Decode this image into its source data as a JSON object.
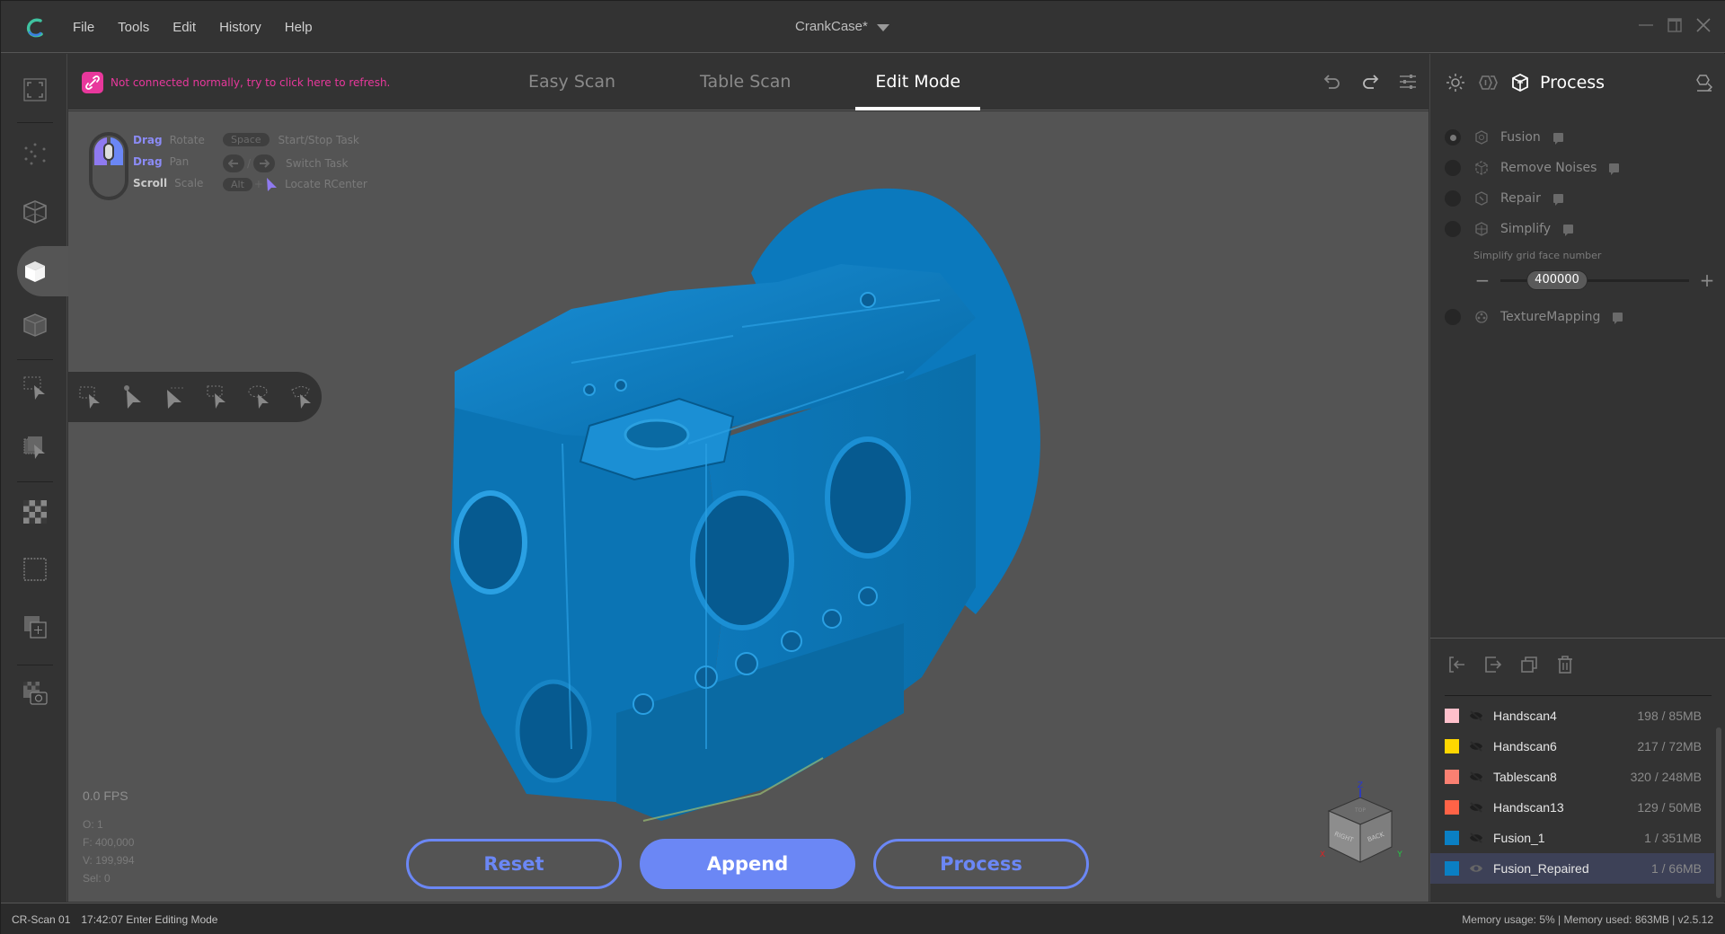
{
  "app": {
    "logo": "crealscan-logo-icon",
    "menu": [
      "File",
      "Tools",
      "Edit",
      "History",
      "Help"
    ],
    "document_title": "CrankCase*",
    "window_controls": [
      "minimize-icon",
      "maximize-icon",
      "close-icon"
    ]
  },
  "header": {
    "warning": "Not connected normally, try to click here to refresh.",
    "tabs": [
      {
        "label": "Easy Scan",
        "active": false
      },
      {
        "label": "Table Scan",
        "active": false
      },
      {
        "label": "Edit Mode",
        "active": true
      }
    ],
    "tools": [
      "undo-icon",
      "redo-icon",
      "settings-sliders-icon"
    ]
  },
  "left_toolbar": {
    "items": [
      "fit-view-icon",
      "point-cloud-icon",
      "wireframe-cube-icon",
      "solid-cube-icon",
      "transparent-cube-icon",
      "rect-select-icon",
      "through-select-icon",
      "checker-texture-icon",
      "dashed-box-icon",
      "add-layer-icon",
      "texture-camera-icon"
    ],
    "active_item": "solid-cube-icon"
  },
  "selection_toolbar": {
    "items": [
      "point-select-icon",
      "brush-select-icon",
      "line-select-icon",
      "rect-select-icon",
      "lasso-select-icon",
      "polygon-select-icon"
    ]
  },
  "hints": {
    "rows": [
      {
        "key": "Drag",
        "action": "Rotate",
        "shortcut": "Space",
        "shortcut_action": "Start/Stop Task"
      },
      {
        "key": "Drag",
        "action": "Pan",
        "shortcut": "← / →",
        "shortcut_action": "Switch Task"
      },
      {
        "key": "Scroll",
        "action": "Scale",
        "shortcut": "Alt +",
        "shortcut_action": "Locate RCenter"
      }
    ],
    "arrow_separator": "/",
    "plus": "+"
  },
  "viewport": {
    "fps": "0.0 FPS",
    "stats": [
      "O: 1",
      "F: 400,000",
      "V: 199,994",
      "Sel: 0"
    ],
    "model_color": "#0a7fc4",
    "background": "#545454",
    "navcube": {
      "faces": [
        "TOP",
        "RIGHT",
        "BACK"
      ],
      "axes": [
        "Z",
        "X",
        "Y"
      ]
    }
  },
  "actions": {
    "reset": "Reset",
    "append": "Append",
    "process": "Process",
    "accent": "#6b87f5"
  },
  "right_panel": {
    "title": "Process",
    "header_icons": [
      "lighting-icon",
      "texture-toggle-icon",
      "process-cube-icon",
      "export-icon"
    ],
    "steps": [
      {
        "label": "Fusion",
        "checked": true,
        "icon": "fusion-icon"
      },
      {
        "label": "Remove Noises",
        "checked": false,
        "icon": "remove-noises-icon"
      },
      {
        "label": "Repair",
        "checked": false,
        "icon": "repair-icon"
      },
      {
        "label": "Simplify",
        "checked": false,
        "icon": "simplify-icon"
      },
      {
        "label": "TextureMapping",
        "checked": false,
        "icon": "texture-mapping-icon"
      }
    ],
    "simplify": {
      "label": "Simplify grid face number",
      "value": "400000",
      "slider_fraction": 0.2,
      "minus": "−",
      "plus": "+"
    },
    "layer_tools": [
      "import-icon",
      "export-layer-icon",
      "duplicate-icon",
      "delete-icon"
    ],
    "layers": [
      {
        "name": "Handscan4",
        "info": "198 / 85MB",
        "color": "#ffc0cb",
        "visible": false,
        "selected": false
      },
      {
        "name": "Handscan6",
        "info": "217 / 72MB",
        "color": "#ffd700",
        "visible": false,
        "selected": false
      },
      {
        "name": "Tablescan8",
        "info": "320 / 248MB",
        "color": "#fa8072",
        "visible": false,
        "selected": false
      },
      {
        "name": "Handscan13",
        "info": "129 / 50MB",
        "color": "#ff6347",
        "visible": false,
        "selected": false
      },
      {
        "name": "Fusion_1",
        "info": "1 / 351MB",
        "color": "#0a7fc4",
        "visible": false,
        "selected": false
      },
      {
        "name": "Fusion_Repaired",
        "info": "1 / 66MB",
        "color": "#0a7fc4",
        "visible": true,
        "selected": true
      }
    ]
  },
  "statusbar": {
    "device": "CR-Scan 01",
    "message": "17:42:07 Enter Editing Mode",
    "memory": "Memory usage: 5% | Memory used: 863MB | v2.5.12"
  }
}
